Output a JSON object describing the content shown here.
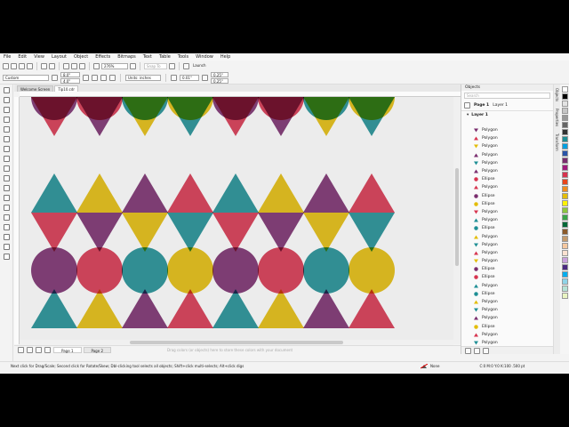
{
  "menu": [
    "File",
    "Edit",
    "View",
    "Layout",
    "Object",
    "Effects",
    "Bitmaps",
    "Text",
    "Table",
    "Tools",
    "Window",
    "Help"
  ],
  "toolbar": {
    "zoom": "276%",
    "snap_label": "Snap To",
    "launch_label": "Launch"
  },
  "propbar": {
    "preset": "Custom",
    "width": "8.0\"",
    "height": "4.0\"",
    "units": "Units: inches",
    "nudge": "0.01\"",
    "dup_x": "0.25\"",
    "dup_y": "0.25\""
  },
  "doc_tabs": [
    {
      "label": "Welcome Screen",
      "active": false
    },
    {
      "label": "Tip10.cdr",
      "active": true
    }
  ],
  "pages": [
    "Page 1",
    "Page 2"
  ],
  "canvas_hint": "Drag colors (or objects) here to store these colors with your document",
  "docker": {
    "title": "Objects",
    "search_placeholder": "Search",
    "page": "Page 1",
    "layer_path": "Layer 1",
    "layer": "Layer 1",
    "objects": [
      {
        "name": "Polygon",
        "color": "#7a2d6e",
        "shape": "tri"
      },
      {
        "name": "Polygon",
        "color": "#d7344f",
        "shape": "tri"
      },
      {
        "name": "Polygon",
        "color": "#e3bd0a",
        "shape": "tri"
      },
      {
        "name": "Polygon",
        "color": "#7a2d6e",
        "shape": "tri"
      },
      {
        "name": "Polygon",
        "color": "#1f8f95",
        "shape": "tri"
      },
      {
        "name": "Polygon",
        "color": "#7a2d6e",
        "shape": "tri"
      },
      {
        "name": "Ellipse",
        "color": "#d7344f",
        "shape": "circ"
      },
      {
        "name": "Polygon",
        "color": "#d7344f",
        "shape": "tri"
      },
      {
        "name": "Ellipse",
        "color": "#7a2d6e",
        "shape": "circ"
      },
      {
        "name": "Ellipse",
        "color": "#e3bd0a",
        "shape": "circ"
      },
      {
        "name": "Polygon",
        "color": "#d7344f",
        "shape": "tri"
      },
      {
        "name": "Polygon",
        "color": "#1f8f95",
        "shape": "tri"
      },
      {
        "name": "Ellipse",
        "color": "#1f8f95",
        "shape": "circ"
      },
      {
        "name": "Polygon",
        "color": "#e3bd0a",
        "shape": "tri"
      },
      {
        "name": "Polygon",
        "color": "#1f8f95",
        "shape": "tri"
      },
      {
        "name": "Polygon",
        "color": "#d7344f",
        "shape": "tri"
      },
      {
        "name": "Polygon",
        "color": "#e3bd0a",
        "shape": "tri"
      },
      {
        "name": "Ellipse",
        "color": "#7a2d6e",
        "shape": "circ"
      },
      {
        "name": "Ellipse",
        "color": "#d7344f",
        "shape": "circ"
      },
      {
        "name": "Polygon",
        "color": "#1f8f95",
        "shape": "tri"
      },
      {
        "name": "Ellipse",
        "color": "#1f8f95",
        "shape": "circ"
      },
      {
        "name": "Polygon",
        "color": "#e3bd0a",
        "shape": "tri"
      },
      {
        "name": "Polygon",
        "color": "#1f8f95",
        "shape": "tri"
      },
      {
        "name": "Polygon",
        "color": "#7a2d6e",
        "shape": "tri"
      },
      {
        "name": "Ellipse",
        "color": "#e3bd0a",
        "shape": "circ"
      },
      {
        "name": "Polygon",
        "color": "#d7344f",
        "shape": "tri"
      },
      {
        "name": "Polygon",
        "color": "#1f8f95",
        "shape": "tri"
      },
      {
        "name": "Polygon",
        "color": "#7a2d6e",
        "shape": "tri"
      }
    ]
  },
  "side_tabs": [
    "Objects",
    "Properties",
    "Transform"
  ],
  "palette": [
    "#ffffff",
    "#000000",
    "#e3e3e3",
    "#c6c6c6",
    "#999999",
    "#666666",
    "#333333",
    "#1f8f95",
    "#00a0e0",
    "#2a55a8",
    "#7a2d6e",
    "#a0197c",
    "#d7344f",
    "#e8451c",
    "#f08c1e",
    "#e3bd0a",
    "#fff200",
    "#8dc63f",
    "#3aa548",
    "#006838",
    "#8b5a2b",
    "#c49a6c",
    "#f5c8a0",
    "#fbe1d0",
    "#c9a0dc",
    "#4b2a80",
    "#00aeef",
    "#8fd4e8",
    "#b5e2d6",
    "#e9f4c2"
  ],
  "status": {
    "hint": "Next click for Drag/Scale; Second click for Rotate/Skew; Dbl-clicking tool selects all objects; Shift+click multi-selects; Alt+click digs",
    "fill": "None",
    "cmyk": "C:0 M:0 Y:0 K:100 .500 pt"
  },
  "artwork": {
    "colors": {
      "magenta": "#d7344f",
      "purple": "#7a2d6e",
      "yellow": "#e3bd0a",
      "teal": "#1f8f95",
      "background": "#ececec"
    },
    "rows": [
      {
        "kind": "down",
        "colors": [
          "magenta",
          "purple",
          "yellow",
          "teal",
          "magenta",
          "purple",
          "yellow",
          "teal"
        ]
      },
      {
        "kind": "circles",
        "colors": [
          "purple",
          "magenta",
          "teal",
          "yellow",
          "purple",
          "magenta",
          "teal",
          "yellow"
        ]
      },
      {
        "kind": "up",
        "colors": [
          "teal",
          "yellow",
          "purple",
          "magenta",
          "teal",
          "yellow",
          "purple",
          "magenta"
        ]
      },
      {
        "kind": "down",
        "colors": [
          "magenta",
          "purple",
          "yellow",
          "teal",
          "magenta",
          "purple",
          "yellow",
          "teal"
        ]
      },
      {
        "kind": "circles",
        "colors": [
          "purple",
          "magenta",
          "teal",
          "yellow",
          "purple",
          "magenta",
          "teal",
          "yellow"
        ]
      },
      {
        "kind": "up",
        "colors": [
          "teal",
          "yellow",
          "purple",
          "magenta",
          "teal",
          "yellow",
          "purple",
          "magenta"
        ]
      }
    ]
  }
}
